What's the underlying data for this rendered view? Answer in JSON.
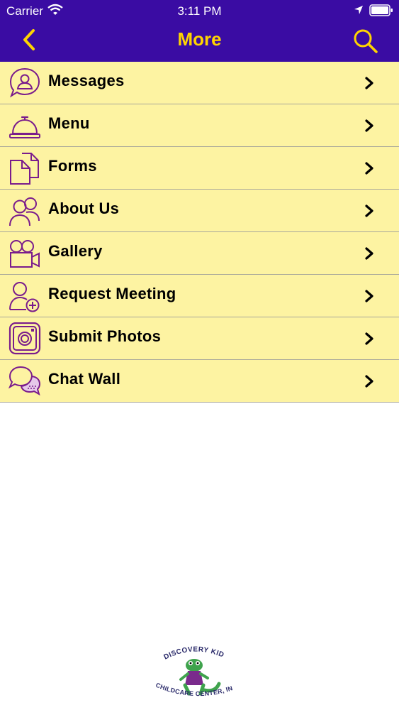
{
  "status_bar": {
    "carrier": "Carrier",
    "time": "3:11 PM"
  },
  "header": {
    "title": "More"
  },
  "colors": {
    "header_bg": "#3a0ca3",
    "accent": "#ffd400",
    "list_bg": "#fdf3a2",
    "icon": "#7a1c8c"
  },
  "menu": [
    {
      "label": "Messages",
      "icon": "person-bubble-icon"
    },
    {
      "label": "Menu",
      "icon": "service-bell-icon"
    },
    {
      "label": "Forms",
      "icon": "documents-icon"
    },
    {
      "label": "About Us",
      "icon": "people-icon"
    },
    {
      "label": "Gallery",
      "icon": "video-camera-icon"
    },
    {
      "label": "Request Meeting",
      "icon": "add-person-icon"
    },
    {
      "label": "Submit Photos",
      "icon": "camera-icon"
    },
    {
      "label": "Chat Wall",
      "icon": "chat-bubbles-icon"
    }
  ],
  "footer": {
    "logo_text_top": "DISCOVERY KIDS",
    "logo_text_bottom": "CHILDCARE CENTER, INC."
  }
}
